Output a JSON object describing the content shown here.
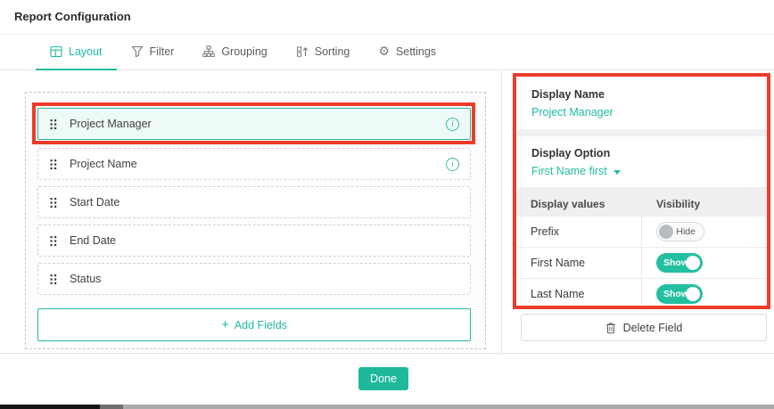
{
  "header": {
    "title": "Report Configuration"
  },
  "tabs": [
    {
      "label": "Layout",
      "icon": "layout-icon",
      "active": true
    },
    {
      "label": "Filter",
      "icon": "filter-icon",
      "active": false
    },
    {
      "label": "Grouping",
      "icon": "grouping-icon",
      "active": false
    },
    {
      "label": "Sorting",
      "icon": "sorting-icon",
      "active": false
    },
    {
      "label": "Settings",
      "icon": "gear-icon",
      "active": false
    }
  ],
  "fields": {
    "items": [
      {
        "label": "Project Manager",
        "selected": true,
        "has_info": true
      },
      {
        "label": "Project Name",
        "selected": false,
        "has_info": true
      },
      {
        "label": "Start Date",
        "selected": false,
        "has_info": false
      },
      {
        "label": "End Date",
        "selected": false,
        "has_info": false
      },
      {
        "label": "Status",
        "selected": false,
        "has_info": false
      }
    ],
    "add_plus": "+",
    "add_label": "Add Fields"
  },
  "details": {
    "display_name_label": "Display Name",
    "display_name_value": "Project Manager",
    "display_option_label": "Display Option",
    "display_option_value": "First Name first",
    "table": {
      "headers": [
        "Display values",
        "Visibility"
      ],
      "rows": [
        {
          "label": "Prefix",
          "toggle_label": "Hide",
          "state": "off"
        },
        {
          "label": "First Name",
          "toggle_label": "Show",
          "state": "on"
        },
        {
          "label": "Last Name",
          "toggle_label": "Show",
          "state": "on"
        }
      ]
    },
    "delete_label": "Delete Field"
  },
  "footer": {
    "done_label": "Done"
  },
  "icons": {
    "gear": "⚙",
    "info": "i"
  },
  "colors": {
    "accent": "#1ebba0",
    "annotation": "#ee3b2a",
    "selected_row_bg": "#eefaf7"
  }
}
